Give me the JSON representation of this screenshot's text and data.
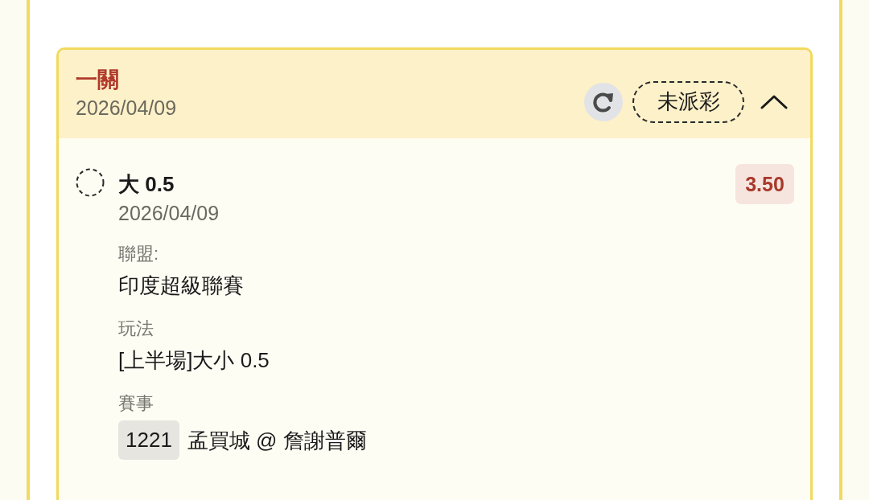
{
  "bet_slip": {
    "title": "一關",
    "date": "2026/04/09",
    "status": "未派彩",
    "expanded": true,
    "selections": [
      {
        "selection": "大 0.5",
        "date": "2026/04/09",
        "odds": "3.50",
        "details": [
          {
            "label": "聯盟:",
            "value": "印度超級聯賽"
          },
          {
            "label": "玩法",
            "value": "[上半場]大小 0.5"
          },
          {
            "label": "賽事",
            "match_id": "1221",
            "value": "孟買城 @ 詹謝普爾"
          }
        ]
      }
    ]
  }
}
